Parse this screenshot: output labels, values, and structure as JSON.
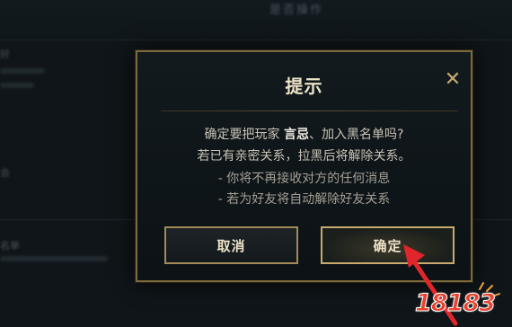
{
  "background": {
    "title": "是否操作",
    "lines": [
      "好",
      "会",
      "名单"
    ]
  },
  "dialog": {
    "title": "提示",
    "close_symbol": "✕",
    "message_prefix": "确定要把玩家",
    "player_name": "言忌",
    "message_suffix": "、加入黑名单吗?",
    "line2": "若已有亲密关系，拉黑后将解除关系。",
    "line3": "- 你将不再接收对方的任何消息",
    "line4": "- 若为好友将自动解除好友关系",
    "cancel_label": "取消",
    "confirm_label": "确定"
  },
  "watermark": {
    "text": "18183"
  },
  "colors": {
    "gold": "#c8aa6e",
    "arrow": "#e0262a",
    "watermark": "#e8432e"
  }
}
